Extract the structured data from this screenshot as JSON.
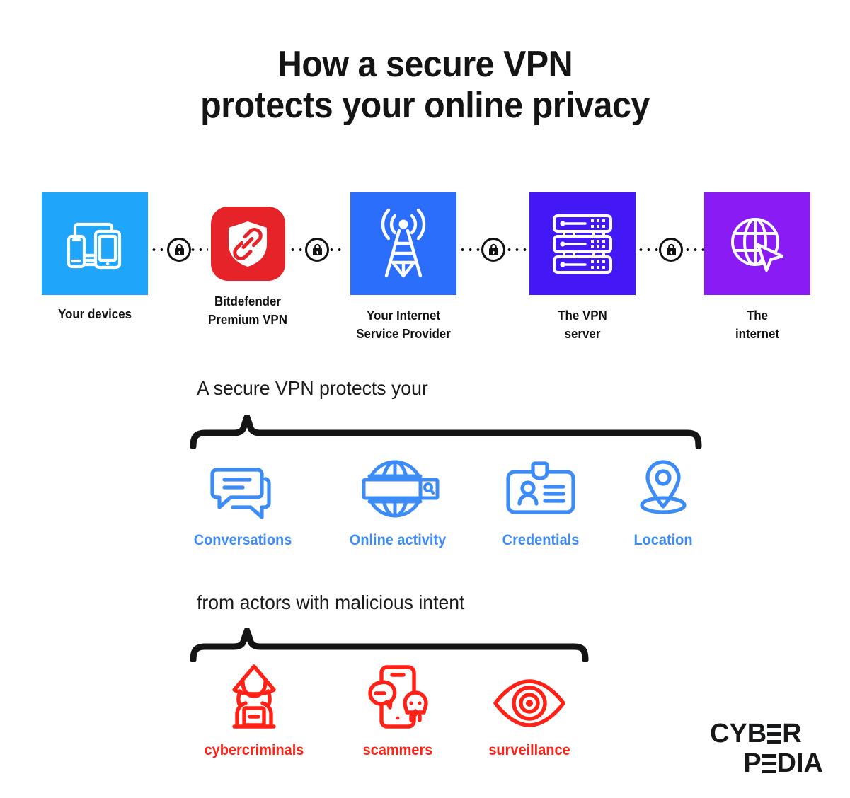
{
  "title": {
    "line1": "How a secure VPN",
    "line2": "protects your online privacy"
  },
  "flow": {
    "nodes": [
      {
        "label_line1": "Your devices",
        "label_line2": "",
        "icon": "devices-icon",
        "color": "#1FA5FA",
        "shape": "square"
      },
      {
        "label_line1": "Bitdefender",
        "label_line2": "Premium VPN",
        "icon": "shield-link-icon",
        "color": "#E52329",
        "shape": "rounded"
      },
      {
        "label_line1": "Your Internet",
        "label_line2": "Service Provider",
        "icon": "radio-tower-icon",
        "color": "#2B6EFB",
        "shape": "square"
      },
      {
        "label_line1": "The VPN",
        "label_line2": "server",
        "icon": "server-rack-icon",
        "color": "#4318F5",
        "shape": "square"
      },
      {
        "label_line1": "The",
        "label_line2": "internet",
        "icon": "globe-cursor-icon",
        "color": "#8B1BF5",
        "shape": "square"
      }
    ],
    "connector_icon": "lock-icon",
    "connector_count": 4
  },
  "protects": {
    "heading": "A secure VPN protects your",
    "accent_color": "#3D8BF5",
    "items": [
      {
        "label": "Conversations",
        "icon": "chat-bubbles-icon"
      },
      {
        "label": "Online activity",
        "icon": "globe-search-icon"
      },
      {
        "label": "Credentials",
        "icon": "id-badge-icon"
      },
      {
        "label": "Location",
        "icon": "map-pin-icon"
      }
    ]
  },
  "threats": {
    "heading": "from actors with malicious intent",
    "accent_color": "#FF2116",
    "items": [
      {
        "label": "cybercriminals",
        "icon": "hooded-hacker-icon"
      },
      {
        "label": "scammers",
        "icon": "phone-skull-icon"
      },
      {
        "label": "surveillance",
        "icon": "eye-icon"
      }
    ]
  },
  "logo": {
    "line1_a": "CYB",
    "line1_e": "E",
    "line1_b": "R",
    "line2_p": "P",
    "line2_e": "E",
    "line2_b": "DIA",
    "name": "CYBERPEDIA"
  }
}
